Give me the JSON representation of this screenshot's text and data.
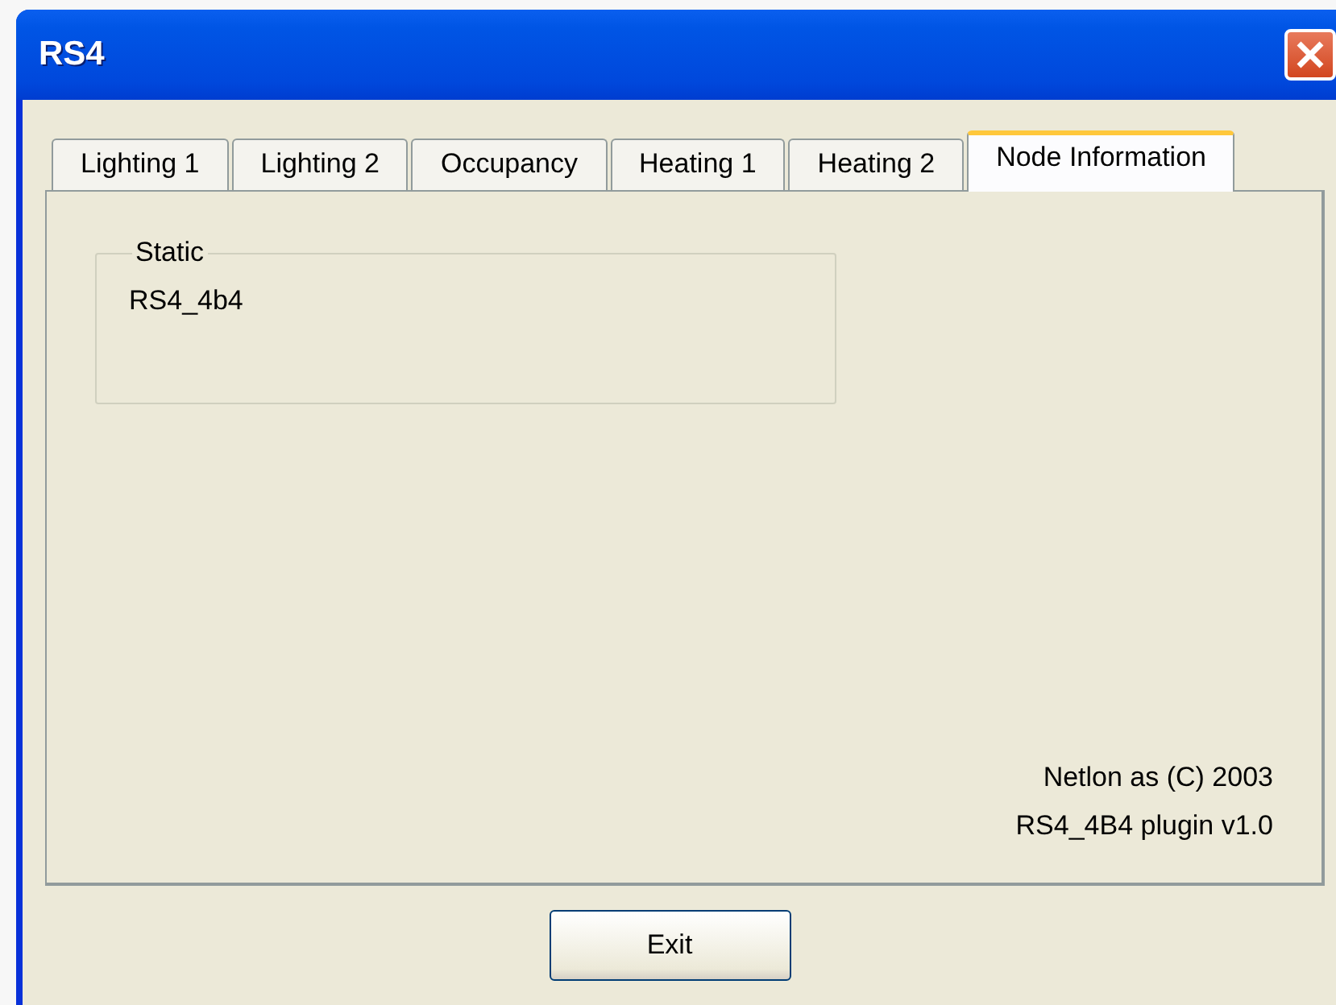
{
  "window": {
    "title": "RS4"
  },
  "tabs": [
    {
      "label": "Lighting 1",
      "selected": false
    },
    {
      "label": "Lighting 2",
      "selected": false
    },
    {
      "label": "Occupancy",
      "selected": false
    },
    {
      "label": "Heating 1",
      "selected": false
    },
    {
      "label": "Heating 2",
      "selected": false
    },
    {
      "label": "Node Information",
      "selected": true
    }
  ],
  "group": {
    "label": "Static",
    "text": "RS4_4b4"
  },
  "footer": [
    "Netlon as (C) 2003",
    "RS4_4B4 plugin v1.0"
  ],
  "buttons": [
    {
      "label": "Exit"
    }
  ]
}
